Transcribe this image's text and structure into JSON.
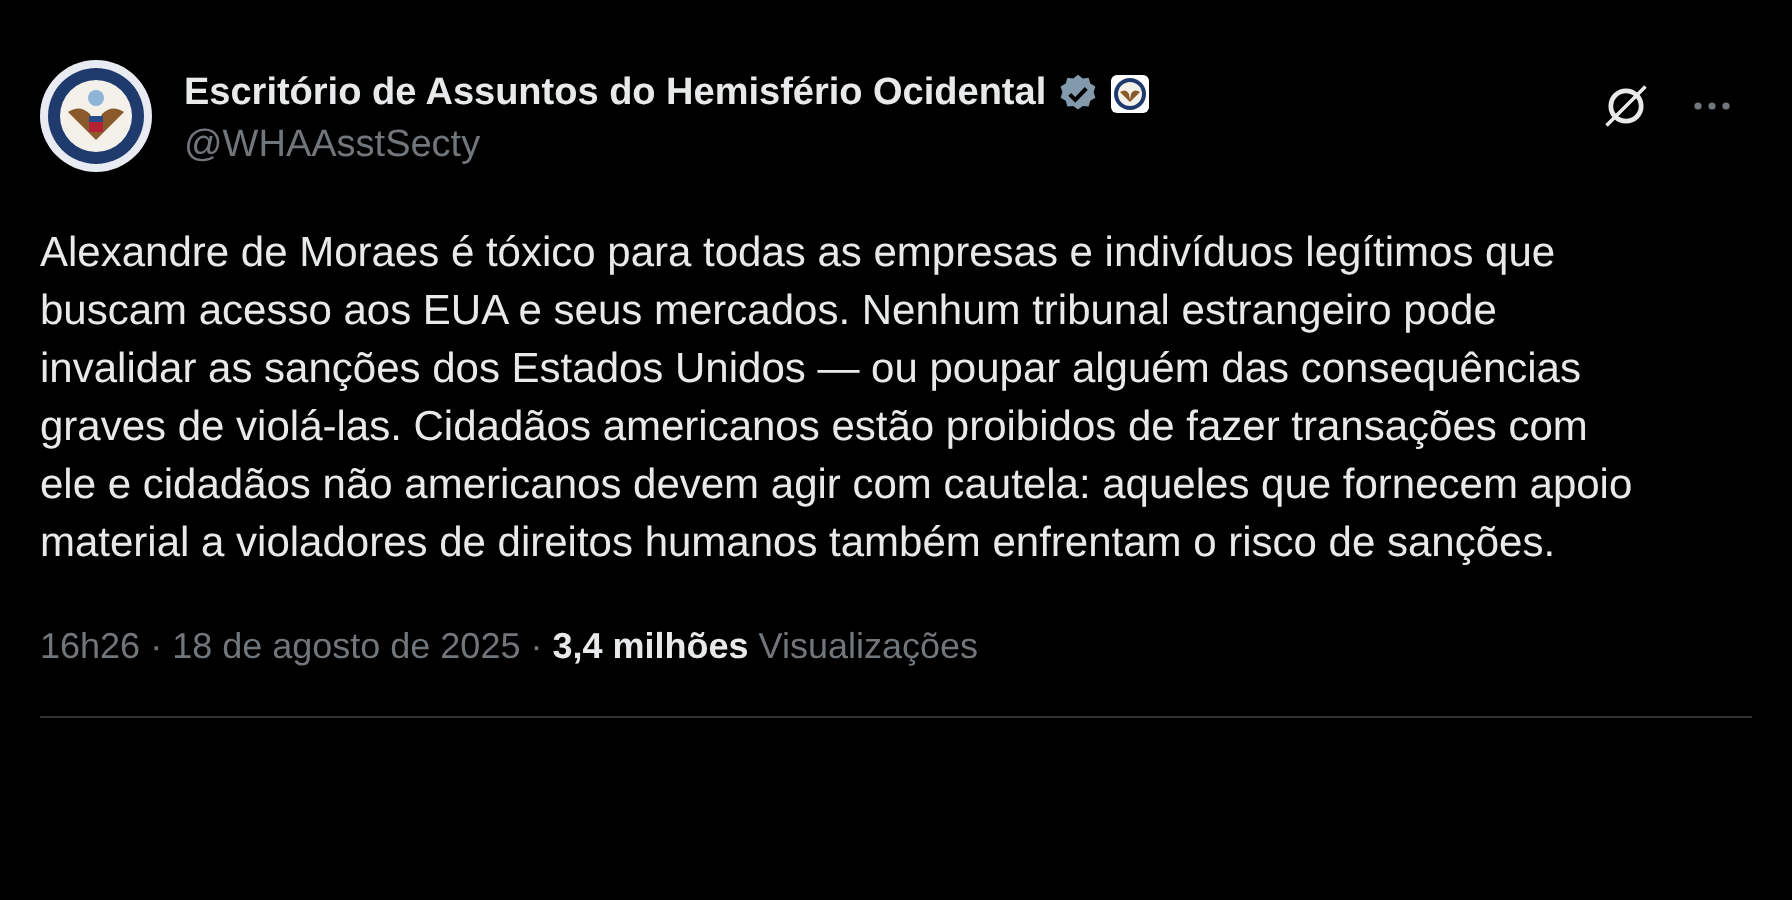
{
  "author": {
    "name": "Escritório de Assuntos do Hemisfério Ocidental",
    "verified": true,
    "handle": "@WHAAsstSecty"
  },
  "body": "Alexandre de Moraes é tóxico para todas as empresas e indivíduos legítimos que buscam acesso aos EUA e seus mercados. Nenhum tribunal estrangeiro pode invalidar as sanções dos Estados Unidos — ou poupar alguém das consequências graves de violá-las. Cidadãos americanos estão proibidos de fazer transações com ele e cidadãos não americanos devem agir com cautela: aqueles que fornecem apoio material a violadores de direitos humanos também enfrentam o risco de sanções.",
  "meta": {
    "time": "16h26",
    "separator_1": "·",
    "date": "18 de agosto de 2025",
    "separator_2": "·",
    "views_count": "3,4 milhões",
    "views_label": "Visualizações"
  }
}
